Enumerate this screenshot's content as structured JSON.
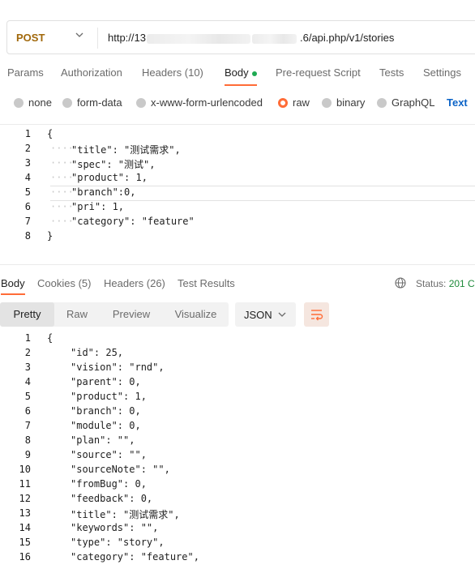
{
  "request": {
    "method": "POST",
    "url_prefix": "http://13",
    "url_suffix": ".6/api.php/v1/stories"
  },
  "tabs": [
    {
      "label": "Params",
      "count": ""
    },
    {
      "label": "Authorization",
      "count": ""
    },
    {
      "label": "Headers",
      "count": "(10)"
    },
    {
      "label": "Body",
      "count": ""
    },
    {
      "label": "Pre-request Script",
      "count": ""
    },
    {
      "label": "Tests",
      "count": ""
    },
    {
      "label": "Settings",
      "count": ""
    }
  ],
  "body_types": [
    "none",
    "form-data",
    "x-www-form-urlencoded",
    "raw",
    "binary",
    "GraphQL"
  ],
  "body_selected": "raw",
  "body_format_label": "Text",
  "request_body": {
    "line_numbers": [
      "1",
      "2",
      "3",
      "4",
      "5",
      "6",
      "7",
      "8"
    ],
    "lines": [
      "{",
      "\"title\": \"测试需求\",",
      "\"spec\": \"测试\",",
      "\"product\": 1,",
      "\"branch\":0,",
      "\"pri\": 1,",
      "\"category\": \"feature\"",
      "}"
    ]
  },
  "response_tabs": [
    {
      "label": "Body",
      "count": ""
    },
    {
      "label": "Cookies",
      "count": "(5)"
    },
    {
      "label": "Headers",
      "count": "(26)"
    },
    {
      "label": "Test Results",
      "count": ""
    }
  ],
  "status": {
    "label": "Status:",
    "value": "201 C"
  },
  "format_buttons": [
    "Pretty",
    "Raw",
    "Preview",
    "Visualize"
  ],
  "format_active": "Pretty",
  "format_select": "JSON",
  "response_body": {
    "line_numbers": [
      "1",
      "2",
      "3",
      "4",
      "5",
      "6",
      "7",
      "8",
      "9",
      "10",
      "11",
      "12",
      "13",
      "14",
      "15",
      "16"
    ],
    "lines": [
      "{",
      "\"id\": 25,",
      "\"vision\": \"rnd\",",
      "\"parent\": 0,",
      "\"product\": 1,",
      "\"branch\": 0,",
      "\"module\": 0,",
      "\"plan\": \"\",",
      "\"source\": \"\",",
      "\"sourceNote\": \"\",",
      "\"fromBug\": 0,",
      "\"feedback\": 0,",
      "\"title\": \"测试需求\",",
      "\"keywords\": \"\",",
      "\"type\": \"story\",",
      "\"category\": \"feature\","
    ]
  },
  "colors": {
    "accent": "#ff6c37",
    "method": "#a1680b",
    "link": "#0b63c7",
    "status_ok": "#1e8a3a"
  }
}
